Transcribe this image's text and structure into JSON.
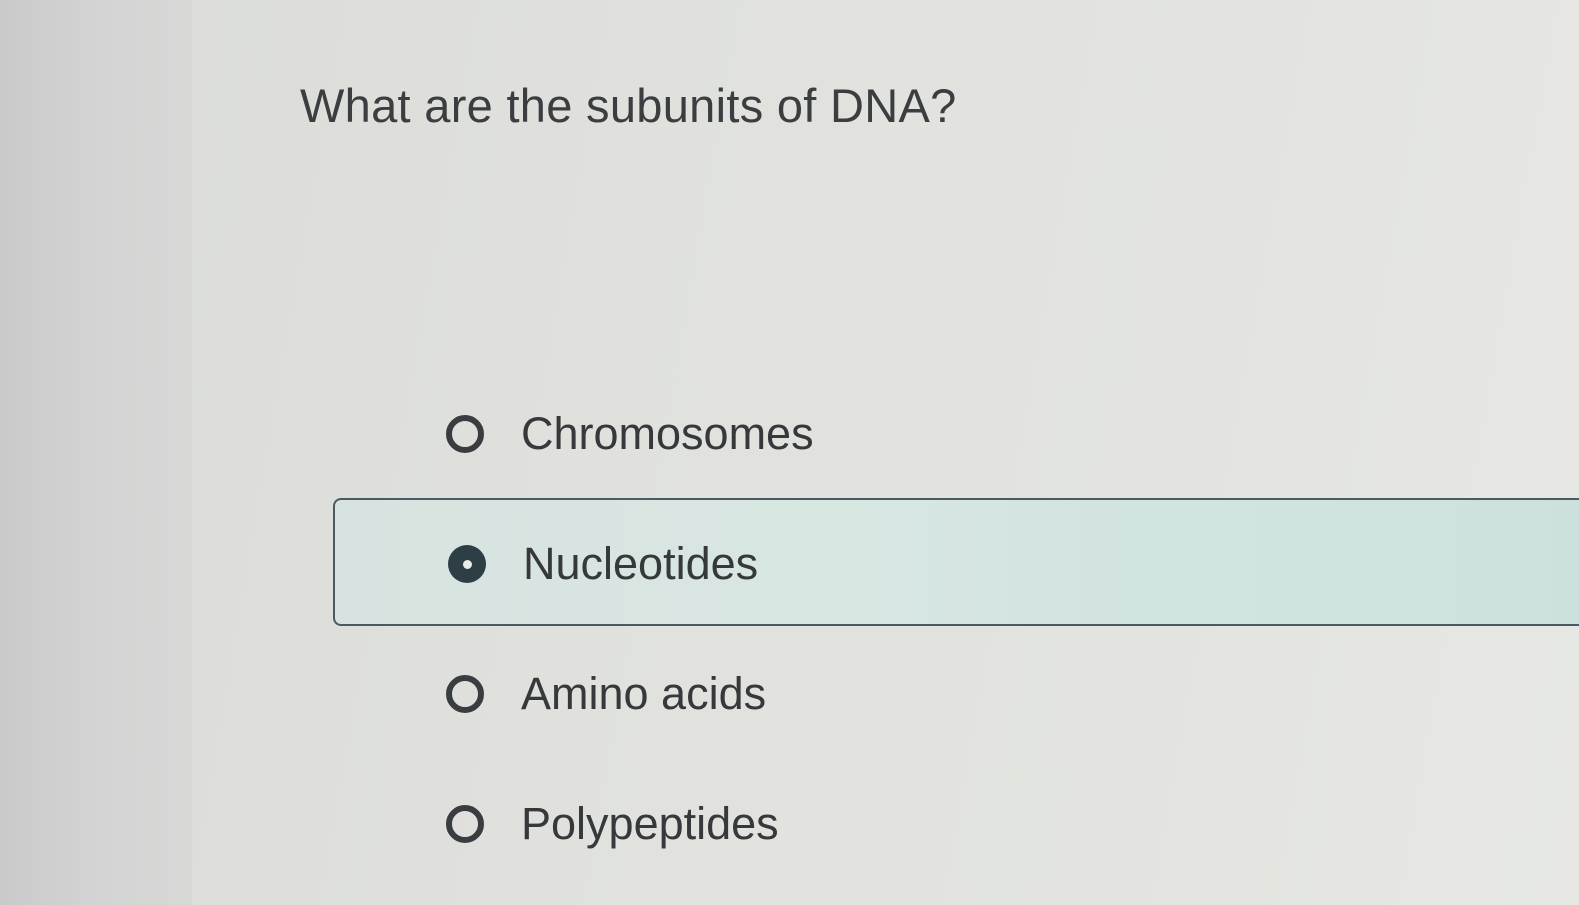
{
  "question": {
    "text": "What are the subunits of DNA?"
  },
  "options": [
    {
      "label": "Chromosomes",
      "selected": false
    },
    {
      "label": "Nucleotides",
      "selected": true
    },
    {
      "label": "Amino acids",
      "selected": false
    },
    {
      "label": "Polypeptides",
      "selected": false
    }
  ],
  "colors": {
    "selected_background": "#d6e4e0",
    "selected_border": "#4a5a63",
    "radio": "#3a3d40",
    "text": "#36393c"
  },
  "icons": {
    "radio_unselected": "radio-unselected-icon",
    "radio_selected": "radio-selected-icon"
  }
}
